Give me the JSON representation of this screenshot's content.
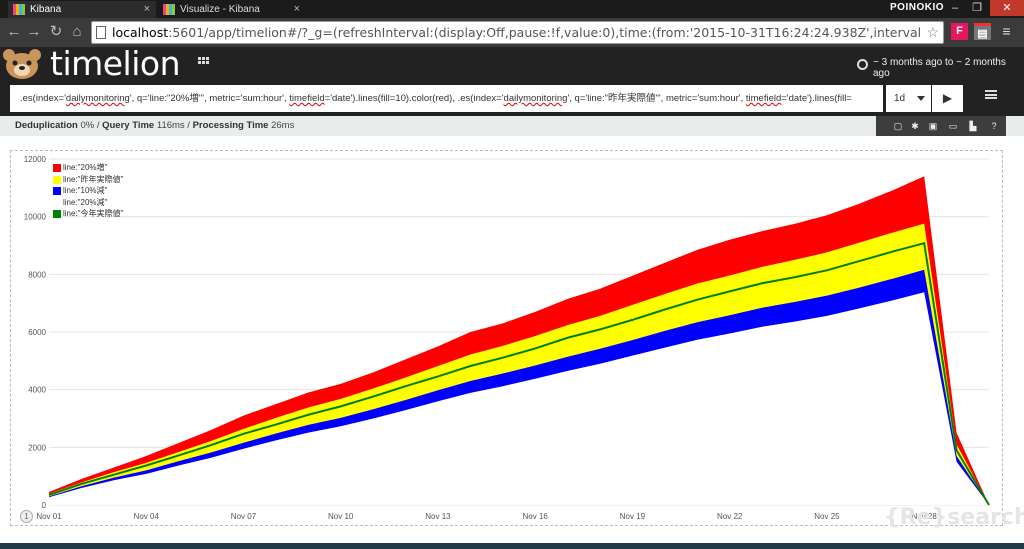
{
  "browser": {
    "tabs": [
      {
        "title": "Kibana",
        "active": true
      },
      {
        "title": "Visualize - Kibana",
        "active": false
      }
    ],
    "user": "POINOKIO",
    "url_host": "localhost",
    "url_rest": ":5601/app/timelion#/?_g=(refreshInterval:(display:Off,pause:!f,value:0),time:(from:'2015-10-31T16:24:24.938Z',interval:'1d',mode:absolute,timezone:"
  },
  "app": {
    "logo": "timelion",
    "time_range": "~ 3 months ago to ~ 2 months ago"
  },
  "expression": {
    "prefix1": " .es(index='",
    "idx1": "dailymonitoring",
    "mid1": "', q='line:\"20%増\"', metric='sum:hour', ",
    "tf1": "timefield",
    "tail1": "='date').lines(fill=10).color(red),   .es(index='",
    "idx2": "dailymonitoring",
    "mid2": "', q='line:\"昨年実際値\"', metric='sum:hour', ",
    "tf2": "timefield",
    "tail2": "='date').lines(fill=",
    "interval": "1d"
  },
  "stats": {
    "dedup_label": "Deduplication",
    "dedup_value": "0%",
    "query_label": "Query Time",
    "query_value": "116ms",
    "proc_label": "Processing Time",
    "proc_value": "26ms"
  },
  "watermark": "{Re}search",
  "page_indicator": "1",
  "colors": {
    "red": "#ff0000",
    "yellow": "#ffff00",
    "blue": "#0000ff",
    "green": "#008000"
  },
  "chart_data": {
    "type": "area",
    "x": [
      "Nov 01",
      "Nov 02",
      "Nov 03",
      "Nov 04",
      "Nov 05",
      "Nov 06",
      "Nov 07",
      "Nov 08",
      "Nov 09",
      "Nov 10",
      "Nov 11",
      "Nov 12",
      "Nov 13",
      "Nov 14",
      "Nov 15",
      "Nov 16",
      "Nov 17",
      "Nov 18",
      "Nov 19",
      "Nov 20",
      "Nov 21",
      "Nov 22",
      "Nov 23",
      "Nov 24",
      "Nov 25",
      "Nov 26",
      "Nov 27",
      "Nov 28",
      "Nov 29",
      "Nov 30"
    ],
    "xticks": [
      "Nov 01",
      "Nov 04",
      "Nov 07",
      "Nov 10",
      "Nov 13",
      "Nov 16",
      "Nov 19",
      "Nov 22",
      "Nov 25",
      "Nov 28"
    ],
    "yticks": [
      0,
      2000,
      4000,
      6000,
      8000,
      10000,
      12000
    ],
    "ylim": [
      0,
      12000
    ],
    "series": [
      {
        "name": "line:\"20%増\"",
        "color": "#ff0000",
        "values": [
          450,
          900,
          1300,
          1700,
          2150,
          2600,
          3100,
          3500,
          3900,
          4200,
          4600,
          5050,
          5500,
          6000,
          6300,
          6700,
          7150,
          7500,
          7950,
          8400,
          8850,
          9200,
          9500,
          9750,
          10050,
          10450,
          10900,
          11400,
          2500,
          0
        ]
      },
      {
        "name": "line:\"昨年実際値\"",
        "color": "#ffff00",
        "values": [
          390,
          780,
          1140,
          1460,
          1840,
          2220,
          2640,
          3020,
          3380,
          3680,
          4040,
          4420,
          4820,
          5220,
          5520,
          5860,
          6240,
          6560,
          6940,
          7320,
          7680,
          7960,
          8260,
          8500,
          8760,
          9100,
          9440,
          9760,
          2100,
          0
        ]
      },
      {
        "name": "line:\"10%減\"",
        "color": "#0000ff",
        "values": [
          300,
          650,
          950,
          1200,
          1520,
          1820,
          2160,
          2480,
          2780,
          3020,
          3320,
          3640,
          3980,
          4300,
          4560,
          4840,
          5140,
          5420,
          5720,
          6040,
          6340,
          6580,
          6840,
          7040,
          7260,
          7540,
          7840,
          8160,
          1700,
          0
        ]
      },
      {
        "name": "line:\"20%減\"",
        "color": "#ffffff",
        "values": [
          270,
          590,
          860,
          1080,
          1370,
          1640,
          1950,
          2240,
          2510,
          2730,
          3000,
          3290,
          3600,
          3890,
          4120,
          4380,
          4650,
          4900,
          5180,
          5460,
          5730,
          5950,
          6180,
          6360,
          6560,
          6820,
          7090,
          7380,
          1500,
          0
        ]
      },
      {
        "name": "line:\"今年実際値\"",
        "color": "#008000",
        "values": [
          350,
          730,
          1050,
          1370,
          1720,
          2080,
          2470,
          2790,
          3130,
          3420,
          3760,
          4120,
          4460,
          4820,
          5110,
          5430,
          5800,
          6090,
          6420,
          6780,
          7120,
          7410,
          7690,
          7900,
          8140,
          8460,
          8780,
          9080,
          1900,
          0
        ]
      }
    ]
  }
}
